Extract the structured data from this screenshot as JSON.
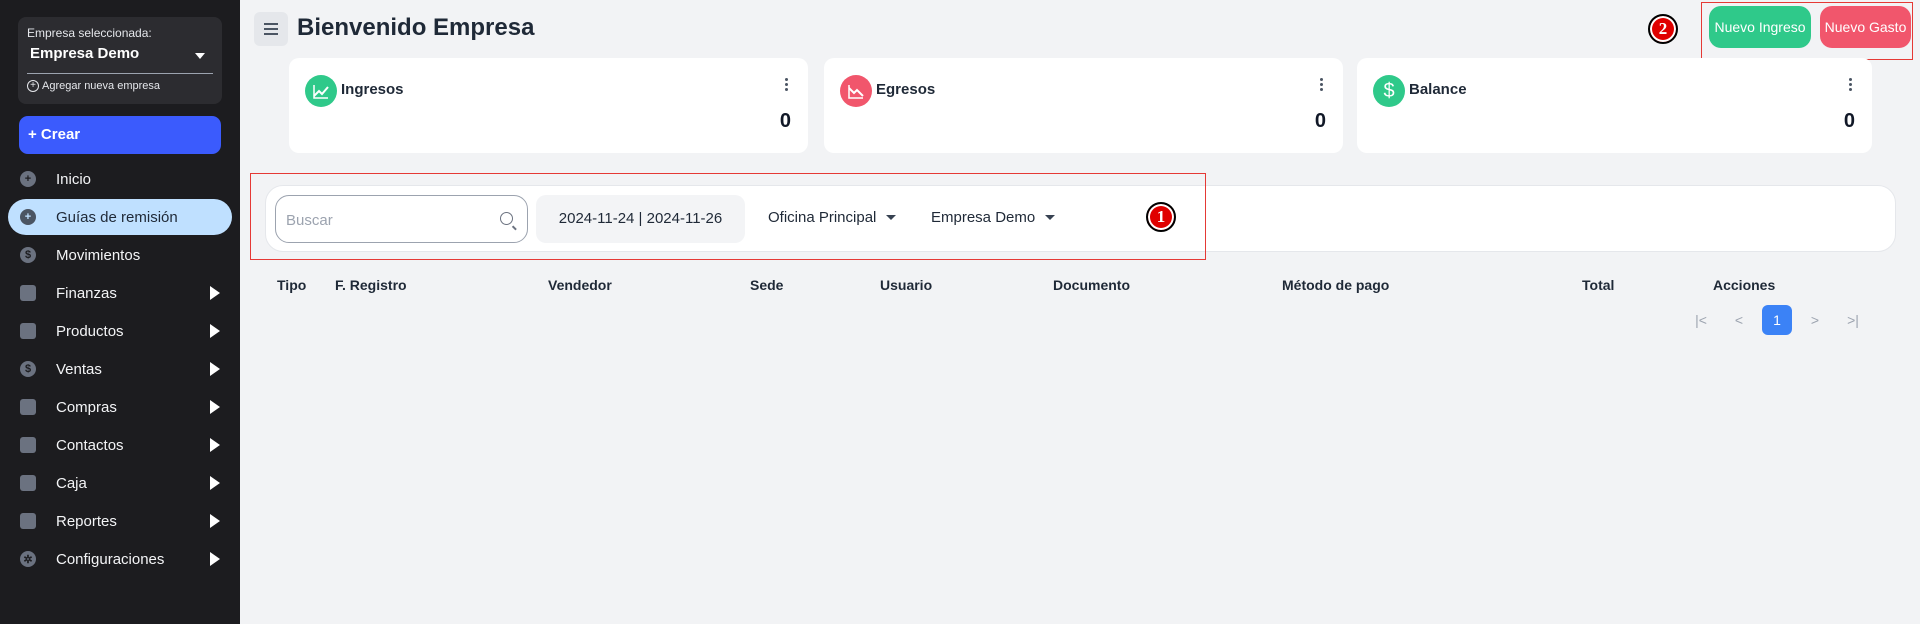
{
  "sidebar": {
    "company_label": "Empresa seleccionada:",
    "company_name": "Empresa Demo",
    "add_company": "Agregar nueva empresa",
    "create_label": "+ Crear",
    "items": [
      {
        "label": "Inicio",
        "icon": "plus-circle-icon"
      },
      {
        "label": "Guías de remisión",
        "icon": "plus-circle-icon"
      },
      {
        "label": "Movimientos",
        "icon": "dollar-icon"
      },
      {
        "label": "Finanzas",
        "icon": "box-icon"
      },
      {
        "label": "Productos",
        "icon": "box-icon"
      },
      {
        "label": "Ventas",
        "icon": "dollar-icon"
      },
      {
        "label": "Compras",
        "icon": "filter-icon"
      },
      {
        "label": "Contactos",
        "icon": "filter-icon"
      },
      {
        "label": "Caja",
        "icon": "wallet-icon"
      },
      {
        "label": "Reportes",
        "icon": "presentation-icon"
      },
      {
        "label": "Configuraciones",
        "icon": "gear-icon"
      }
    ]
  },
  "header": {
    "title": "Bienvenido Empresa",
    "btn_ingreso": "Nuevo Ingreso",
    "btn_gasto": "Nuevo Gasto"
  },
  "markers": {
    "m1": "1",
    "m2": "2"
  },
  "cards": [
    {
      "title": "Ingresos",
      "value": "0",
      "color": "#2fc98a",
      "icon": "chart-up-icon"
    },
    {
      "title": "Egresos",
      "value": "0",
      "color": "#f1566c",
      "icon": "chart-down-icon"
    },
    {
      "title": "Balance",
      "value": "0",
      "color": "#2fc98a",
      "icon": "dollar-icon"
    }
  ],
  "filters": {
    "search_placeholder": "Buscar",
    "date_range": "2024-11-24 | 2024-11-26",
    "office": "Oficina Principal",
    "company": "Empresa Demo"
  },
  "table": {
    "columns": [
      "Tipo",
      "F. Registro",
      "Vendedor",
      "Sede",
      "Usuario",
      "Documento",
      "Método de pago",
      "Total",
      "Acciones"
    ]
  },
  "pagination": {
    "first": "|<",
    "prev": "<",
    "current": "1",
    "next": ">",
    "last": ">|"
  },
  "colors": {
    "accent": "#3b5bfd",
    "active_nav": "#bfe0ff",
    "income": "#2fc98a",
    "expense": "#f1566c"
  }
}
